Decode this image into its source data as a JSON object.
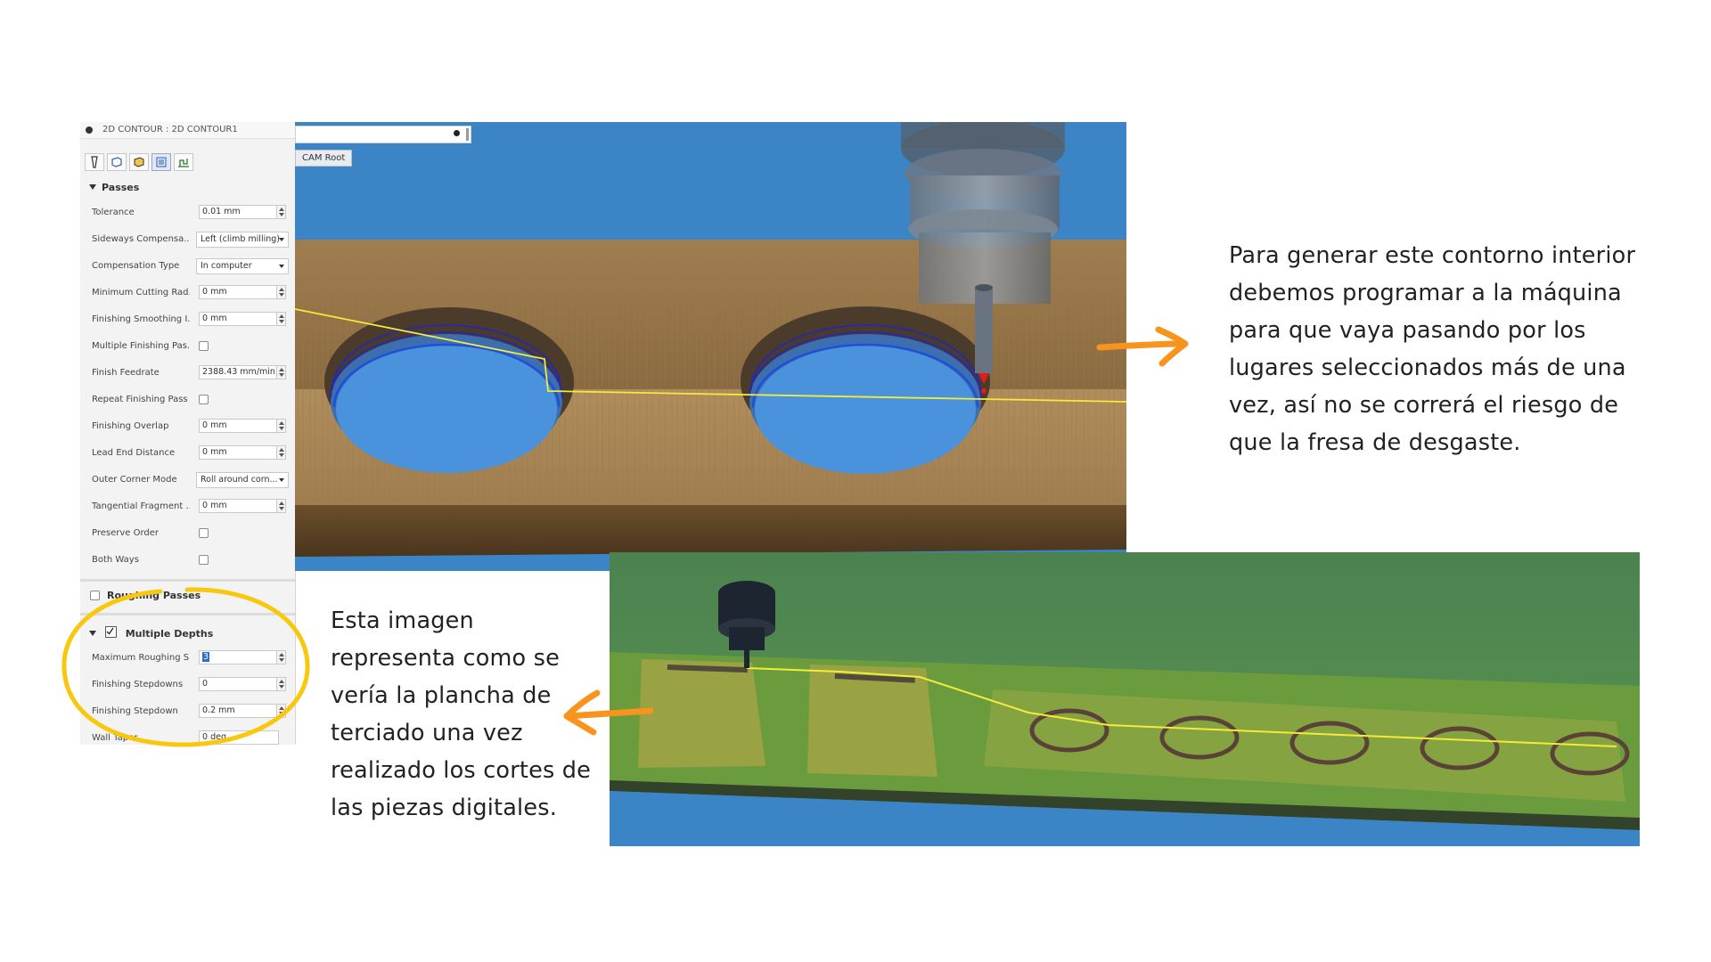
{
  "panel": {
    "title": "2D CONTOUR : 2D CONTOUR1",
    "sections": {
      "passes": "Passes",
      "roughing_passes": "Roughing Passes",
      "multiple_depths": "Multiple Depths"
    },
    "rows": {
      "tolerance": {
        "label": "Tolerance",
        "value": "0.01 mm"
      },
      "sideways": {
        "label": "Sideways Compensa...",
        "value": "Left (climb milling)"
      },
      "compensation_type": {
        "label": "Compensation Type",
        "value": "In computer"
      },
      "min_cutting_radius": {
        "label": "Minimum Cutting Rad...",
        "value": "0 mm"
      },
      "finishing_smoothing": {
        "label": "Finishing Smoothing I...",
        "value": "0 mm"
      },
      "multiple_finishing": {
        "label": "Multiple Finishing Pas..."
      },
      "finish_feedrate": {
        "label": "Finish Feedrate",
        "value": "2388.43 mm/min"
      },
      "repeat_finishing": {
        "label": "Repeat Finishing Pass"
      },
      "finishing_overlap": {
        "label": "Finishing Overlap",
        "value": "0 mm"
      },
      "lead_end_distance": {
        "label": "Lead End Distance",
        "value": "0 mm"
      },
      "outer_corner_mode": {
        "label": "Outer Corner Mode",
        "value": "Roll around corn..."
      },
      "tangential_fragment": {
        "label": "Tangential Fragment ...",
        "value": "0 mm"
      },
      "preserve_order": {
        "label": "Preserve Order"
      },
      "both_ways": {
        "label": "Both Ways"
      },
      "max_roughing": {
        "label": "Maximum Roughing S...",
        "value": "3"
      },
      "finishing_stepdowns": {
        "label": "Finishing Stepdowns",
        "value": "0"
      },
      "finishing_stepdown": {
        "label": "Finishing Stepdown",
        "value": "0.2 mm"
      },
      "wall_taper": {
        "label": "Wall Taper",
        "value": "0 deg"
      }
    },
    "icons": [
      "tool-icon",
      "geometry-icon",
      "heights-icon",
      "passes-icon",
      "linking-icon"
    ]
  },
  "viewport": {
    "cam_root": "CAM Root"
  },
  "text_right": "Para generar este contorno interior debemos programar a la máquina para que vaya pasando por los lugares seleccionados más de una vez, así no se correrá el riesgo de que la fresa de desgaste.",
  "text_left_lines": [
    "Esta imagen",
    "representa como se",
    "vería la plancha de",
    "terciado una vez",
    "realizado los cortes de",
    "las piezas digitales."
  ],
  "text_right_lines": [
    "Para generar este contorno interior",
    "debemos programar a la máquina",
    "para que vaya pasando por los",
    "lugares seleccionados más de una",
    "vez, así no se correrá el riesgo de",
    "que la fresa de desgaste."
  ],
  "colors": {
    "arrow": "#f7941d",
    "highlight_circle": "#f9c80e",
    "viewport_blue": "#3b84c6",
    "toolpath": "#f3ec3a",
    "green_sim": "#4f8a4a"
  }
}
